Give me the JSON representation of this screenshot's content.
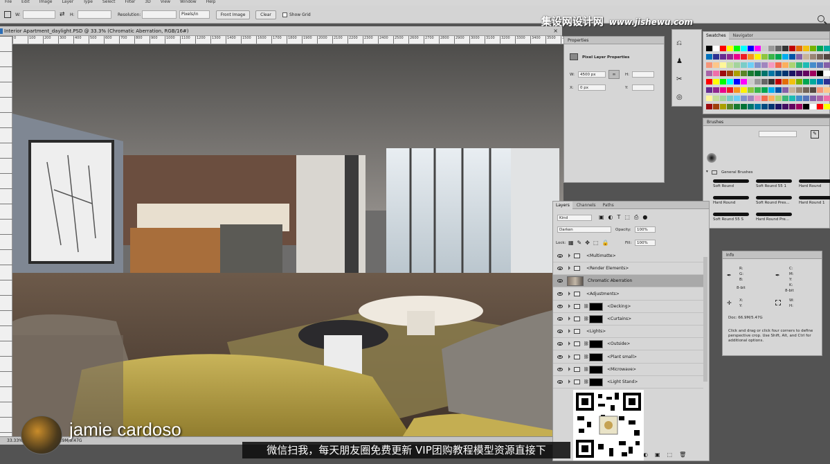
{
  "menubar": {
    "items": [
      "File",
      "Edit",
      "Image",
      "Layer",
      "Type",
      "Select",
      "Filter",
      "3D",
      "View",
      "Window",
      "Help"
    ]
  },
  "options": {
    "w_label": "W:",
    "h_label": "H:",
    "resolution_label": "Resolution:",
    "resolution_unit": "Pixels/in",
    "front_image": "Front Image",
    "clear": "Clear",
    "show_grid": "Show Grid"
  },
  "watermark": {
    "cn": "集设网设计网",
    "url": "www.jishewu.com"
  },
  "document": {
    "tab_title": "Interior Apartment_daylight.PSD @ 33.3% (Chromatic Aberration, RGB/16#)"
  },
  "ruler_top_ticks": [
    "0",
    "100",
    "200",
    "300",
    "400",
    "500",
    "600",
    "700",
    "800",
    "900",
    "1000",
    "1100",
    "1200",
    "1300",
    "1400",
    "1500",
    "1600",
    "1700",
    "1800",
    "1900",
    "2000",
    "2100",
    "2200",
    "2300",
    "2400",
    "2500",
    "2600",
    "2700",
    "2800",
    "2900",
    "3000",
    "3100",
    "3200",
    "3300",
    "3400",
    "3500",
    "3600"
  ],
  "properties": {
    "title": "Properties",
    "subtitle": "Pixel Layer Properties",
    "w_label": "W:",
    "w_value": "4500 px",
    "h_label": "H:",
    "x_label": "X:",
    "x_value": "0 px",
    "y_label": "Y:"
  },
  "swatches": {
    "tab_swatches": "Swatches",
    "tab_navigator": "Navigator"
  },
  "brushes": {
    "title": "Brushes",
    "group": "General Brushes",
    "items": [
      "Soft Round",
      "Soft Round 55 1",
      "Hard Round",
      "Hard Round",
      "Soft Round Pres...",
      "Hard Round 1",
      "Soft Round 55 S",
      "Hard Round Pre..."
    ]
  },
  "layers": {
    "tabs": [
      "Layers",
      "Channels",
      "Paths"
    ],
    "kind": "Kind",
    "blend_mode": "Darken",
    "opacity_label": "Opacity:",
    "opacity_value": "100%",
    "lock_label": "Lock:",
    "fill_label": "Fill:",
    "fill_value": "100%",
    "rows": [
      {
        "name": "<Multimatte>",
        "type": "folder"
      },
      {
        "name": "<Render Elements>",
        "type": "folder"
      },
      {
        "name": "Chromatic Aberration",
        "type": "pixel",
        "selected": true
      },
      {
        "name": "<Adjustments>",
        "type": "folder"
      },
      {
        "name": "<Decking>",
        "type": "masked"
      },
      {
        "name": "<Curtains>",
        "type": "masked"
      },
      {
        "name": "<Lights>",
        "type": "folder"
      },
      {
        "name": "<Outside>",
        "type": "masked"
      },
      {
        "name": "<Plant small>",
        "type": "masked"
      },
      {
        "name": "<Microwave>",
        "type": "masked"
      },
      {
        "name": "<Light Stand>",
        "type": "masked"
      }
    ]
  },
  "info": {
    "title": "Info",
    "rgb": [
      "R:",
      "G:",
      "B:"
    ],
    "bitdepth": "8-bit",
    "cmyk": [
      "C:",
      "M:",
      "Y:",
      "K:"
    ],
    "xy": [
      "X:",
      "Y:"
    ],
    "wh": [
      "W:",
      "H:"
    ],
    "doc": "Doc: 66.9M/5.47G",
    "hint": "Click and drag or click four corners to define perspective crop. Use Shift, Alt, and Ctrl for additional options."
  },
  "status": {
    "zoom": "33.33%",
    "doc": "66.9M/5.47G"
  },
  "overlay": {
    "author": "jamie cardoso",
    "subtitle": "微信扫我，每天朋友圈免费更新 VIP团购教程模型资源直接下"
  },
  "colors": {
    "app_bg": "#535353",
    "panel": "#d6d6d6",
    "selection": "#a9a9a9"
  }
}
